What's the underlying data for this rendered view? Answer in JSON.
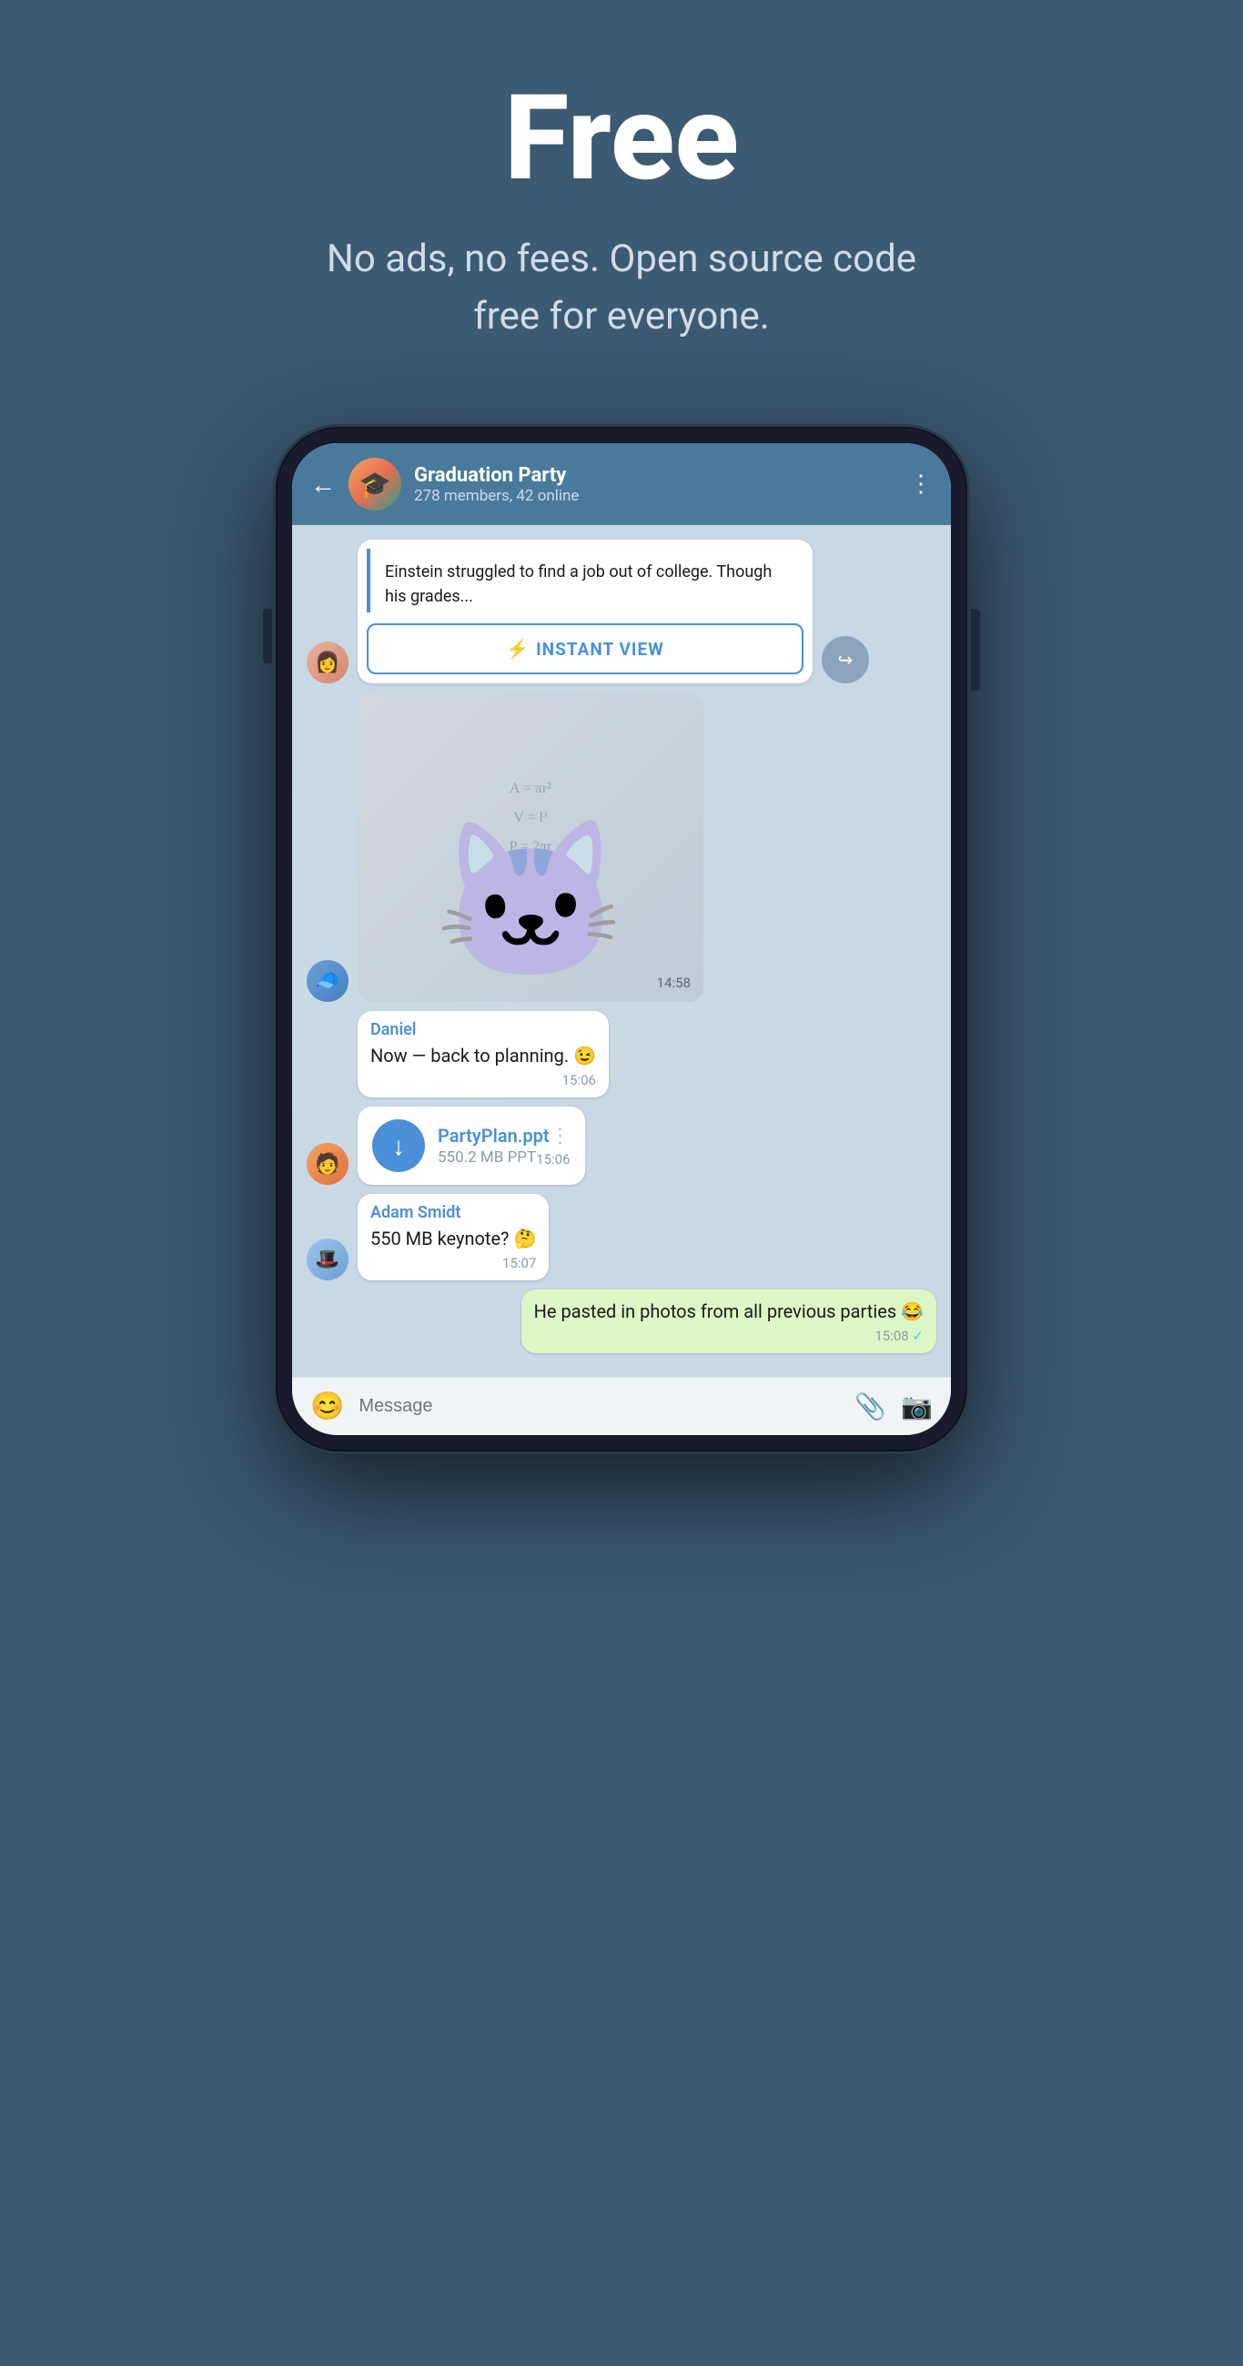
{
  "hero": {
    "title": "Free",
    "subtitle": "No ads, no fees. Open source code free for everyone."
  },
  "chat": {
    "header": {
      "back_label": "←",
      "group_name": "Graduation Party",
      "status": "278 members, 42 online",
      "more_icon": "⋮"
    },
    "messages": [
      {
        "id": "article-msg",
        "type": "article",
        "text": "Einstein struggled to find a job out of college. Though his grades...",
        "instant_view_label": "INSTANT VIEW",
        "instant_view_icon": "⚡"
      },
      {
        "id": "sticker-msg",
        "type": "sticker",
        "time": "14:58"
      },
      {
        "id": "daniel-msg",
        "type": "text",
        "sender": "Daniel",
        "text": "Now — back to planning. 😉",
        "time": "15:06"
      },
      {
        "id": "file-msg",
        "type": "file",
        "file_name": "PartyPlan.ppt",
        "file_size": "550.2 MB PPT",
        "time": "15:06",
        "more_icon": "⋮"
      },
      {
        "id": "adam-msg",
        "type": "text",
        "sender": "Adam Smidt",
        "text": "550 MB keynote? 🤔",
        "time": "15:07"
      },
      {
        "id": "own-msg",
        "type": "own",
        "text": "He pasted in photos from all previous parties 😂",
        "time": "15:08",
        "read": true
      }
    ],
    "input": {
      "placeholder": "Message",
      "emoji_label": "😊",
      "attach_label": "📎",
      "camera_label": "📷"
    }
  },
  "colors": {
    "header_bg": "#4a7a9b",
    "chat_bg": "#c8d8e4",
    "own_bubble": "#dcf8c6",
    "other_bubble": "#ffffff",
    "accent": "#4a90d9"
  }
}
